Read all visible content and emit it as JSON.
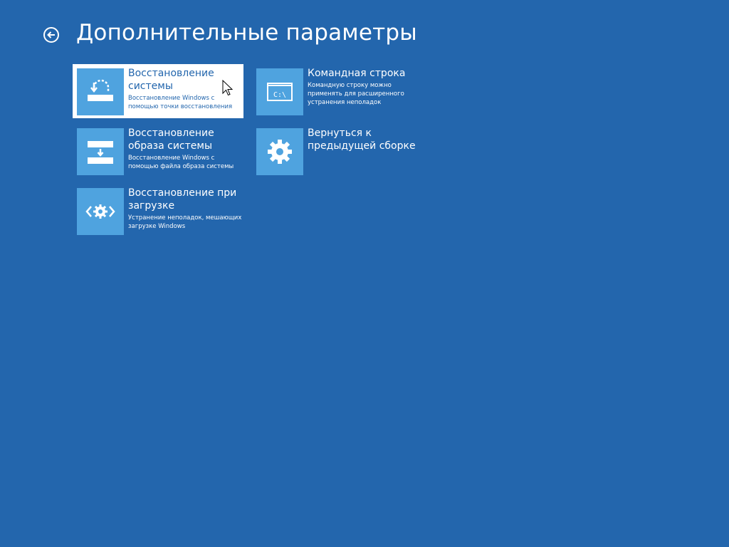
{
  "page": {
    "title": "Дополнительные параметры",
    "back_icon": "back-arrow-circle-icon"
  },
  "options": [
    {
      "title": "Восстановление системы",
      "desc": "Восстановление Windows с помощью точки восстановления",
      "icon": "system-restore-icon",
      "selected": true
    },
    {
      "title": "Командная строка",
      "desc": "Командную строку можно применять для расширенного устранения неполадок",
      "icon": "command-prompt-icon",
      "icon_text": "C:\\",
      "selected": false
    },
    {
      "title": "Восстановление образа системы",
      "desc": "Восстановление Windows с помощью файла образа системы",
      "icon": "system-image-recovery-icon",
      "selected": false
    },
    {
      "title": "Вернуться к предыдущей сборке",
      "desc": "",
      "icon": "gear-icon",
      "selected": false
    },
    {
      "title": "Восстановление при загрузке",
      "desc": "Устранение неполадок, мешающих загрузке Windows",
      "icon": "startup-repair-icon",
      "selected": false
    }
  ],
  "colors": {
    "background": "#2366ad",
    "tile_icon": "#4fa3df",
    "selected_tile": "#ffffff",
    "text": "#ffffff"
  },
  "mouse_cursor_icon": "arrow-cursor-icon"
}
